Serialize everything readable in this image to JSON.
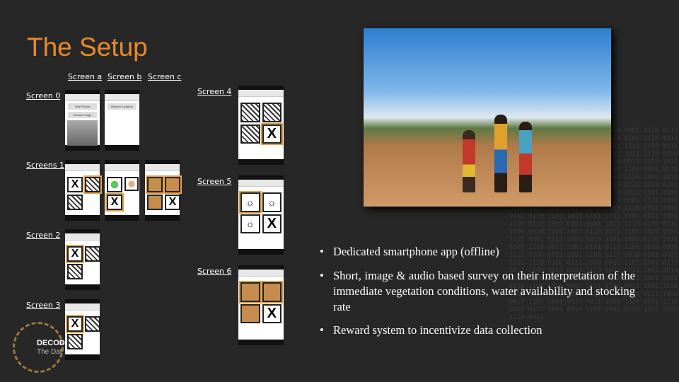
{
  "title": "The Setup",
  "labels": {
    "a": "Screen a",
    "b": "Screen b",
    "c": "Screen c",
    "s0": "Screen 0",
    "s1": "Screens 1",
    "s2": "Screen 2",
    "s3": "Screen 3",
    "s4": "Screen 4",
    "s5": "Screen 5",
    "s6": "Screen 6"
  },
  "phone_buttons": {
    "take_picture": "Take Picture",
    "choose_image": "Choose Image",
    "receive_location": "Receive Location"
  },
  "x_glyph": "X",
  "bullets": [
    "Dedicated smartphone app (offline)",
    "Short, image & audio based survey on their interpretation of the immediate vegetation conditions, water availability and stocking rate",
    "Reward system to incentivize data collection"
  ],
  "bullet_glyph": "•",
  "logo": {
    "text": "DECOD",
    "sub": "The Dat"
  },
  "accent": "#e8892c"
}
